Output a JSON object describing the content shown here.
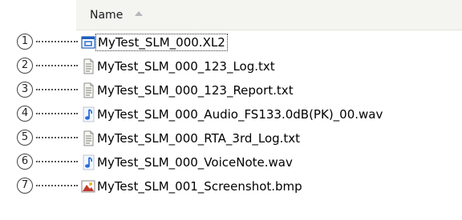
{
  "columns": {
    "name_header": "Name"
  },
  "files": [
    {
      "number": "1",
      "name": "MyTest_SLM_000.XL2",
      "icon": "xl2-file-icon",
      "selected": true
    },
    {
      "number": "2",
      "name": "MyTest_SLM_000_123_Log.txt",
      "icon": "text-file-icon",
      "selected": false
    },
    {
      "number": "3",
      "name": "MyTest_SLM_000_123_Report.txt",
      "icon": "text-file-icon",
      "selected": false
    },
    {
      "number": "4",
      "name": "MyTest_SLM_000_Audio_FS133.0dB(PK)_00.wav",
      "icon": "audio-file-icon",
      "selected": false
    },
    {
      "number": "5",
      "name": "MyTest_SLM_000_RTA_3rd_Log.txt",
      "icon": "text-file-icon",
      "selected": false
    },
    {
      "number": "6",
      "name": "MyTest_SLM_000_VoiceNote.wav",
      "icon": "audio-file-icon",
      "selected": false
    },
    {
      "number": "7",
      "name": "MyTest_SLM_001_Screenshot.bmp",
      "icon": "image-file-icon",
      "selected": false
    }
  ],
  "colors": {
    "header_bg": "#f4f4f0",
    "audio_icon": "#2a6fd8",
    "xl2_icon": "#1f5fb8",
    "image_icon": "#c0392b"
  }
}
